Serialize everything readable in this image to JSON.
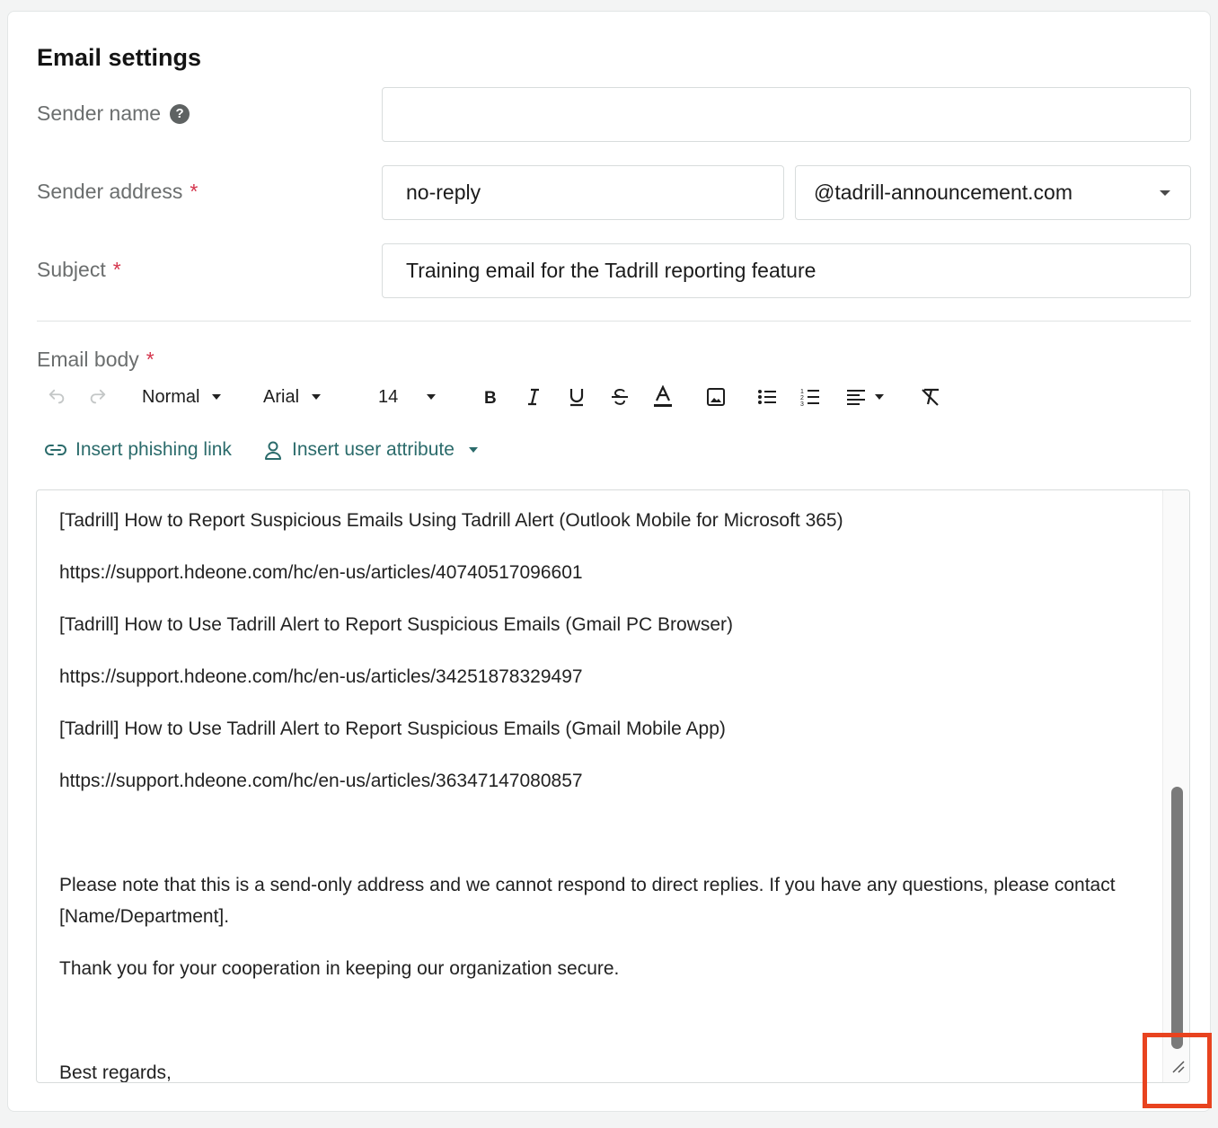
{
  "section": {
    "title": "Email settings"
  },
  "sender_name": {
    "label": "Sender name",
    "value": ""
  },
  "sender_address": {
    "label": "Sender address",
    "required_mark": "*",
    "local_part": "no-reply",
    "domain": "@tadrill-announcement.com"
  },
  "subject": {
    "label": "Subject",
    "required_mark": "*",
    "value": "Training email for the Tadrill reporting feature"
  },
  "email_body": {
    "label": "Email body",
    "required_mark": "*"
  },
  "toolbar": {
    "style": "Normal",
    "font": "Arial",
    "size": "14"
  },
  "actions": {
    "insert_phishing_link": "Insert phishing link",
    "insert_user_attribute": "Insert user attribute"
  },
  "body_lines": {
    "l1": "[Tadrill] How to Report Suspicious Emails Using Tadrill Alert (Outlook Mobile for Microsoft 365)",
    "l2": "https://support.hdeone.com/hc/en-us/articles/40740517096601",
    "l3": "[Tadrill] How to Use Tadrill Alert to Report Suspicious Emails (Gmail PC Browser)",
    "l4": "https://support.hdeone.com/hc/en-us/articles/34251878329497",
    "l5": "[Tadrill] How to Use Tadrill Alert to Report Suspicious Emails (Gmail Mobile App)",
    "l6": "https://support.hdeone.com/hc/en-us/articles/36347147080857",
    "l7": "Please note that this is a send-only address and we cannot respond to direct replies. If you have any questions, please contact [Name/Department].",
    "l8": "Thank you for your cooperation in keeping our organization secure.",
    "l9": "Best regards,"
  },
  "colors": {
    "accent_link": "#2b6b6b",
    "required": "#d4344c",
    "highlight": "#e8431f"
  }
}
